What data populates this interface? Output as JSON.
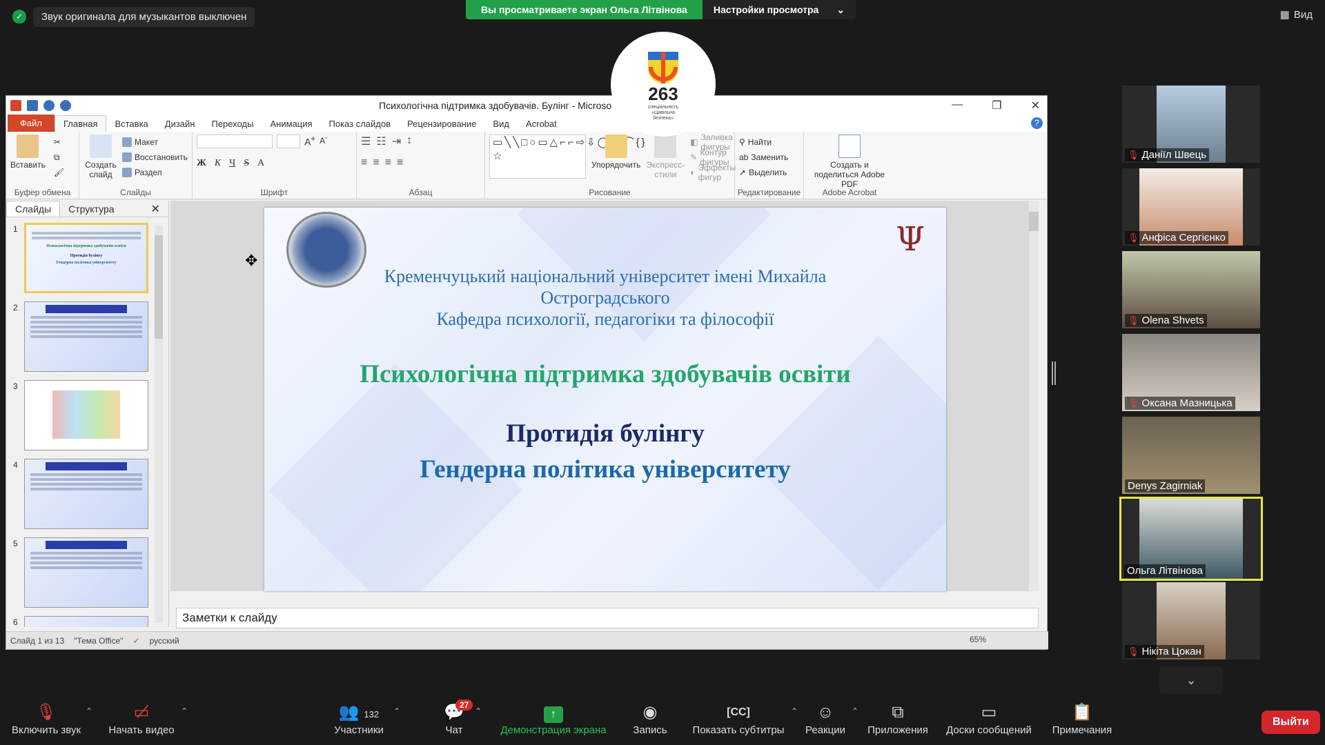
{
  "zoom_app": {
    "audio_notice": "Звук оригинала для музыкантов выключен",
    "share_banner": "Вы просматриваете экран Ольга Літвінова",
    "view_options": "Настройки просмотра",
    "view_button": "Вид",
    "leave_button": "Выйти",
    "badge_logo": {
      "number": "263",
      "caption": "спеціальність «Цивільна безпека»"
    }
  },
  "ppt": {
    "window_title": "Психологічна підтримка здобувачів. Булінг - Microso",
    "tabs": [
      "Файл",
      "Главная",
      "Вставка",
      "Дизайн",
      "Переходы",
      "Анимация",
      "Показ слайдов",
      "Рецензирование",
      "Вид",
      "Acrobat"
    ],
    "active_tab": "Главная",
    "ribbon": {
      "clipboard": {
        "label": "Буфер обмена",
        "paste": "Вставить"
      },
      "slides": {
        "label": "Слайды",
        "new_slide": "Создать слайд",
        "layout": "Макет",
        "reset": "Восстановить",
        "section": "Раздел"
      },
      "font": {
        "label": "Шрифт"
      },
      "paragraph": {
        "label": "Абзац"
      },
      "drawing": {
        "label": "Рисование",
        "arrange": "Упорядочить",
        "quick_styles": "Экспресс-стили",
        "fill": "Заливка фигуры",
        "outline": "Контур фигуры",
        "effects": "Эффекты фигур"
      },
      "editing": {
        "label": "Редактирование",
        "find": "Найти",
        "replace": "Заменить",
        "select": "Выделить"
      },
      "acrobat": {
        "label": "Adobe Acrobat",
        "create_share": "Создать и поделиться Adobe PDF"
      }
    },
    "left_panel": {
      "tab_slides": "Слайды",
      "tab_outline": "Структура",
      "slide_numbers": [
        "1",
        "2",
        "3",
        "4",
        "5",
        "6"
      ]
    },
    "slide": {
      "university": "Кременчуцький національний університет імені Михайла Остроградського",
      "department": "Кафедра психології, педагогіки та філософії",
      "title": "Психологічна підтримка здобувачів освіти",
      "subtitle1": "Протидія булінгу",
      "subtitle2": "Гендерна політика університету"
    },
    "notes_placeholder": "Заметки к слайду",
    "status": {
      "slide_of": "Слайд 1 из 13",
      "theme": "\"Тема Office\"",
      "language": "русский",
      "zoom": "65%"
    }
  },
  "participants": [
    {
      "name": "Даніїл Швець",
      "muted": true
    },
    {
      "name": "Анфіса Сергієнко",
      "muted": true
    },
    {
      "name": "Olena Shvets",
      "muted": true
    },
    {
      "name": "Оксана Мазницька",
      "muted": true
    },
    {
      "name": "Denys Zagirniak",
      "muted": false
    },
    {
      "name": "Ольга Літвінова",
      "muted": false,
      "speaking": true
    },
    {
      "name": "Нікіта Цокан",
      "muted": true
    }
  ],
  "toolbar": {
    "unmute": "Включить звук",
    "start_video": "Начать видео",
    "participants": "Участники",
    "participants_count": "132",
    "chat": "Чат",
    "chat_badge": "27",
    "share_screen": "Демонстрация экрана",
    "record": "Запись",
    "captions": "Показать субтитры",
    "reactions": "Реакции",
    "apps": "Приложения",
    "whiteboards": "Доски сообщений",
    "notes": "Примечания"
  },
  "colors": {
    "share_green": "#23a14a",
    "leave_red": "#d4272c",
    "speaker_border": "#e6e64a",
    "slide_title_green": "#23a66a"
  }
}
